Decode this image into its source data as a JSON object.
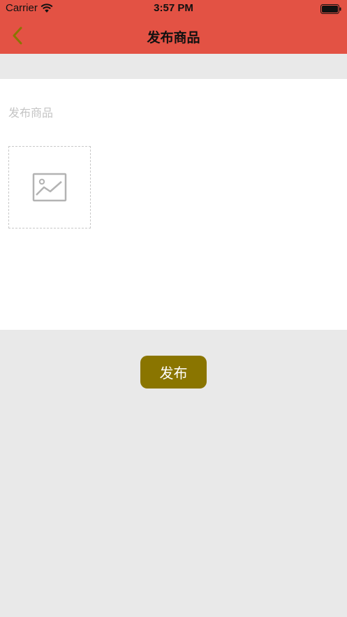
{
  "status_bar": {
    "carrier": "Carrier",
    "time": "3:57 PM"
  },
  "nav": {
    "title": "发布商品",
    "back_icon": "chevron-left-icon",
    "background_color": "#e35244",
    "back_icon_color": "#8a7500"
  },
  "form": {
    "title_placeholder": "发布商品",
    "title_value": "",
    "image_picker_icon": "image-placeholder-icon"
  },
  "actions": {
    "publish_label": "发布",
    "publish_color": "#8a7500"
  }
}
